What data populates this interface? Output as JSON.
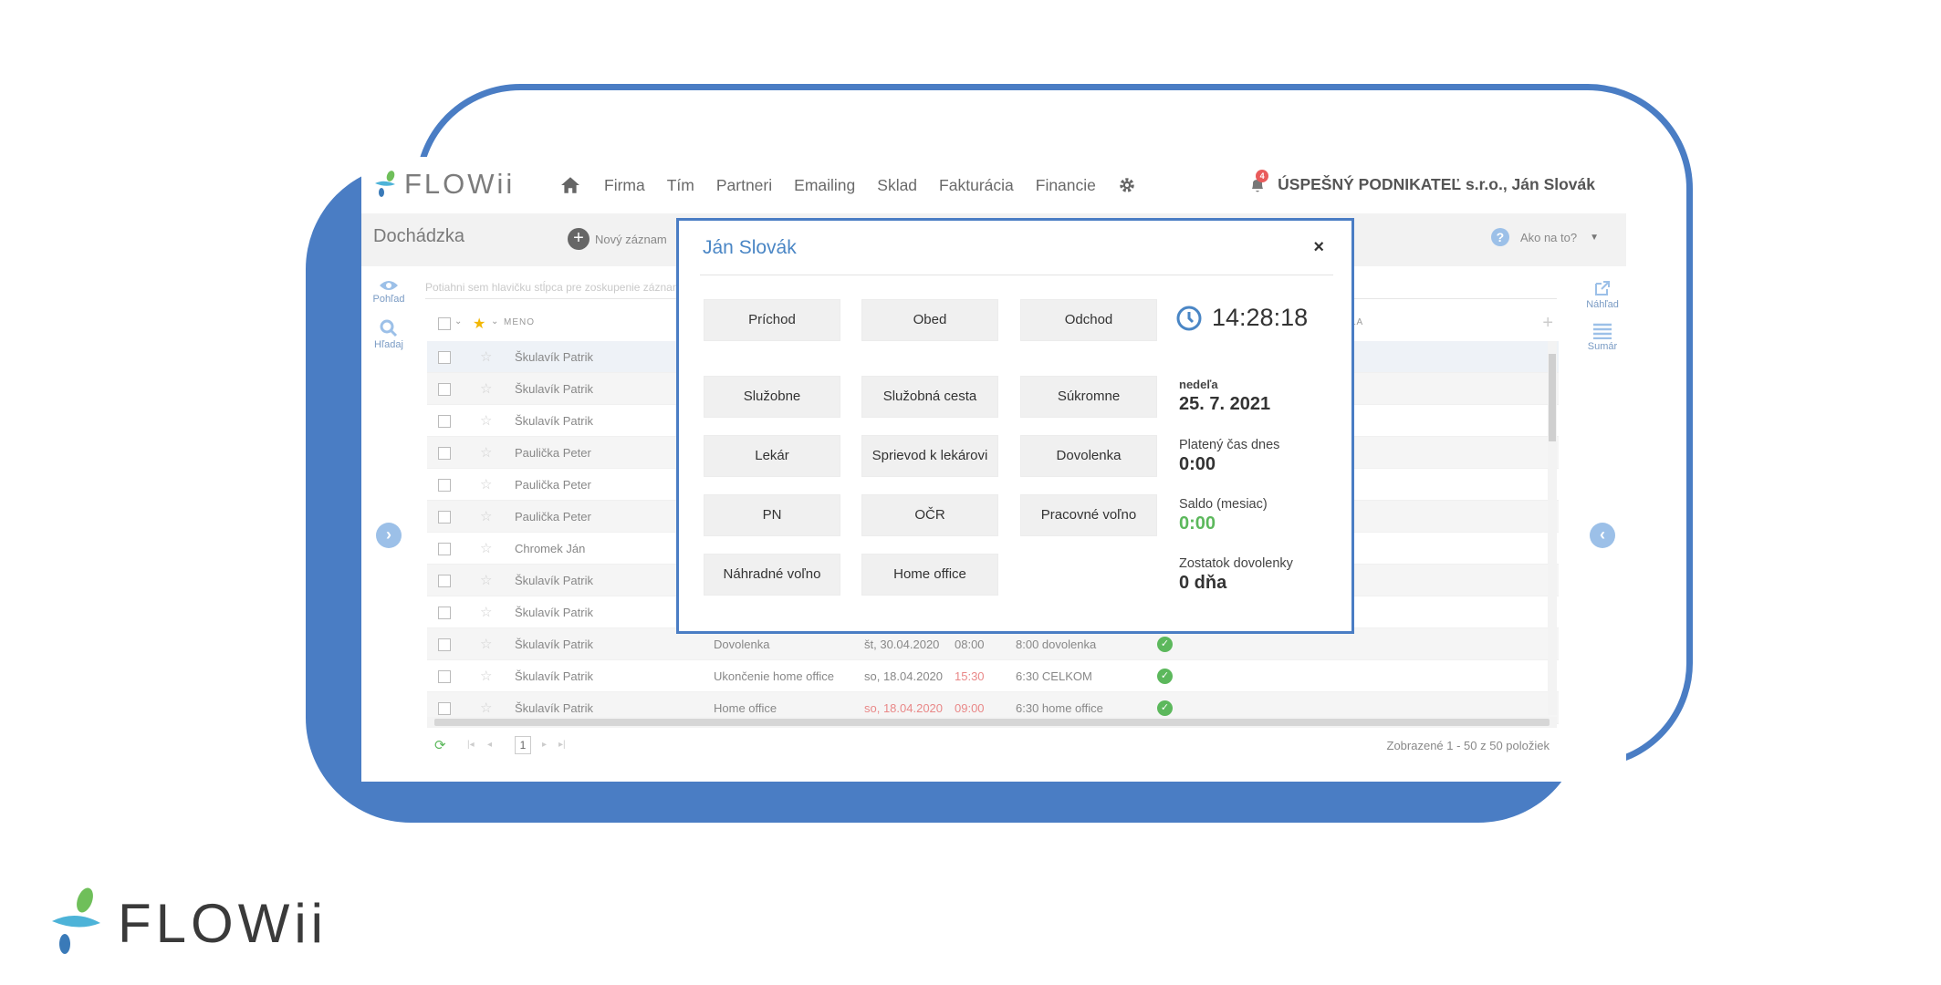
{
  "branding": {
    "logo_text": "FLOWii"
  },
  "nav": {
    "items": [
      "Firma",
      "Tím",
      "Partneri",
      "Emailing",
      "Sklad",
      "Fakturácia",
      "Financie"
    ],
    "notifications_count": "4",
    "company_user": "ÚSPEŠNÝ PODNIKATEĽ s.r.o., Ján Slovák"
  },
  "subheader": {
    "page_title": "Dochádzka",
    "new_record": "Nový záznam",
    "help": "Ako na to?"
  },
  "leftbar": {
    "view": "Pohľad",
    "search": "Hľadaj"
  },
  "rightbar": {
    "preview": "Náhľad",
    "summary": "Sumár"
  },
  "grid": {
    "filter_placeholder": "Potiahni sem hlavičku stĺpca pre zoskupenie záznamov",
    "col_name": "MENO",
    "col_partial": "LA",
    "rows": [
      {
        "name": "Škulavík Patrik",
        "type": "",
        "date": "",
        "time": "",
        "desc": ""
      },
      {
        "name": "Škulavík Patrik",
        "type": "",
        "date": "",
        "time": "",
        "desc": ""
      },
      {
        "name": "Škulavík Patrik",
        "type": "",
        "date": "",
        "time": "",
        "desc": ""
      },
      {
        "name": "Paulička Peter",
        "type": "",
        "date": "",
        "time": "",
        "desc": ""
      },
      {
        "name": "Paulička Peter",
        "type": "",
        "date": "",
        "time": "",
        "desc": ""
      },
      {
        "name": "Paulička Peter",
        "type": "",
        "date": "",
        "time": "",
        "desc": ""
      },
      {
        "name": "Chromek Ján",
        "type": "",
        "date": "",
        "time": "",
        "desc": ""
      },
      {
        "name": "Škulavík Patrik",
        "type": "",
        "date": "",
        "time": "",
        "desc": ""
      },
      {
        "name": "Škulavík Patrik",
        "type": "",
        "date": "",
        "time": "",
        "desc": ""
      },
      {
        "name": "Škulavík Patrik",
        "type": "Dovolenka",
        "date": "št, 30.04.2020",
        "time": "08:00",
        "desc": "8:00 dovolenka"
      },
      {
        "name": "Škulavík Patrik",
        "type": "Ukončenie home office",
        "date": "so, 18.04.2020",
        "time": "15:30",
        "desc": "6:30 CELKOM"
      },
      {
        "name": "Škulavík Patrik",
        "type": "Home office",
        "date": "so, 18.04.2020",
        "time": "09:00",
        "desc": "6:30 home office"
      }
    ],
    "page": "1",
    "summary": "Zobrazené 1 - 50 z 50 položiek"
  },
  "modal": {
    "title": "Ján Slovák",
    "close": "×",
    "buttons": {
      "prichod": "Príchod",
      "obed": "Obed",
      "odchod": "Odchod",
      "sluzobne": "Služobne",
      "sluzobna_cesta": "Služobná cesta",
      "sukromne": "Súkromne",
      "lekar": "Lekár",
      "sprievod": "Sprievod k lekárovi",
      "dovolenka": "Dovolenka",
      "pn": "PN",
      "ocr": "OČR",
      "pracovne_volno": "Pracovné voľno",
      "nahradne_volno": "Náhradné voľno",
      "home_office": "Home office"
    },
    "clock": "14:28:18",
    "day_label": "nedeľa",
    "date": "25. 7. 2021",
    "paid_time_label": "Platený čas dnes",
    "paid_time": "0:00",
    "balance_label": "Saldo (mesiac)",
    "balance": "0:00",
    "vacation_label": "Zostatok dovolenky",
    "vacation": "0 dňa"
  },
  "colors": {
    "accent": "#4a7dc4",
    "success": "#5cb85c"
  }
}
